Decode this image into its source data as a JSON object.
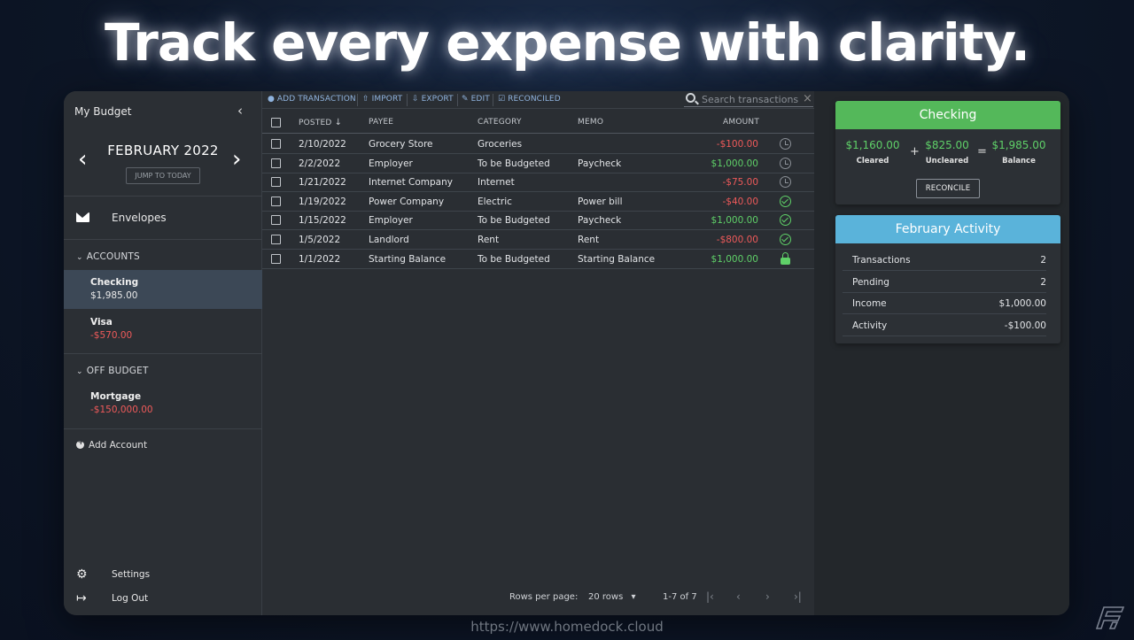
{
  "headline": "Track every expense with clarity.",
  "sidebar": {
    "title": "My Budget",
    "month": "FEBRUARY 2022",
    "jump_label": "JUMP TO TODAY",
    "envelopes_label": "Envelopes",
    "accounts_header": "ACCOUNTS",
    "accounts": [
      {
        "name": "Checking",
        "balance": "$1,985.00"
      },
      {
        "name": "Visa",
        "balance": "-$570.00"
      }
    ],
    "off_budget_header": "OFF BUDGET",
    "off_budget_accounts": [
      {
        "name": "Mortgage",
        "balance": "-$150,000.00"
      }
    ],
    "add_account_label": "Add Account",
    "settings_label": "Settings",
    "logout_label": "Log Out"
  },
  "toolbar": {
    "add_label": "ADD TRANSACTION",
    "import_label": "IMPORT",
    "export_label": "EXPORT",
    "edit_label": "EDIT",
    "reconciled_label": "RECONCILED",
    "search_placeholder": "Search transactions"
  },
  "table": {
    "columns": {
      "posted": "POSTED",
      "payee": "PAYEE",
      "category": "CATEGORY",
      "memo": "MEMO",
      "amount": "AMOUNT"
    },
    "rows": [
      {
        "posted": "2/10/2022",
        "payee": "Grocery Store",
        "category": "Groceries",
        "memo": "",
        "amount": "-$100.00",
        "status": "pending"
      },
      {
        "posted": "2/2/2022",
        "payee": "Employer",
        "category": "To be Budgeted",
        "memo": "Paycheck",
        "amount": "$1,000.00",
        "status": "pending"
      },
      {
        "posted": "1/21/2022",
        "payee": "Internet Company",
        "category": "Internet",
        "memo": "",
        "amount": "-$75.00",
        "status": "pending"
      },
      {
        "posted": "1/19/2022",
        "payee": "Power Company",
        "category": "Electric",
        "memo": "Power bill",
        "amount": "-$40.00",
        "status": "cleared"
      },
      {
        "posted": "1/15/2022",
        "payee": "Employer",
        "category": "To be Budgeted",
        "memo": "Paycheck",
        "amount": "$1,000.00",
        "status": "cleared"
      },
      {
        "posted": "1/5/2022",
        "payee": "Landlord",
        "category": "Rent",
        "memo": "Rent",
        "amount": "-$800.00",
        "status": "cleared"
      },
      {
        "posted": "1/1/2022",
        "payee": "Starting Balance",
        "category": "To be Budgeted",
        "memo": "Starting Balance",
        "amount": "$1,000.00",
        "status": "reconciled"
      }
    ]
  },
  "footer": {
    "rows_per_page_label": "Rows per page:",
    "rows_per_page_value": "20 rows",
    "range": "1-7 of 7"
  },
  "checking_card": {
    "title": "Checking",
    "cleared": "$1,160.00",
    "cleared_label": "Cleared",
    "plus": "+",
    "uncleared": "$825.00",
    "uncleared_label": "Uncleared",
    "equals": "=",
    "balance": "$1,985.00",
    "balance_label": "Balance",
    "reconcile_label": "RECONCILE"
  },
  "activity_card": {
    "title": "February Activity",
    "rows": [
      {
        "label": "Transactions",
        "value": "2"
      },
      {
        "label": "Pending",
        "value": "2"
      },
      {
        "label": "Income",
        "value": "$1,000.00"
      },
      {
        "label": "Activity",
        "value": "-$100.00"
      }
    ]
  },
  "url": "https://www.homedock.cloud",
  "colors": {
    "positive": "#5fd068",
    "negative": "#ef5a5a",
    "checking_header": "#54b85a",
    "activity_header": "#5ab3da",
    "toolbar_link": "#8fb3de"
  }
}
